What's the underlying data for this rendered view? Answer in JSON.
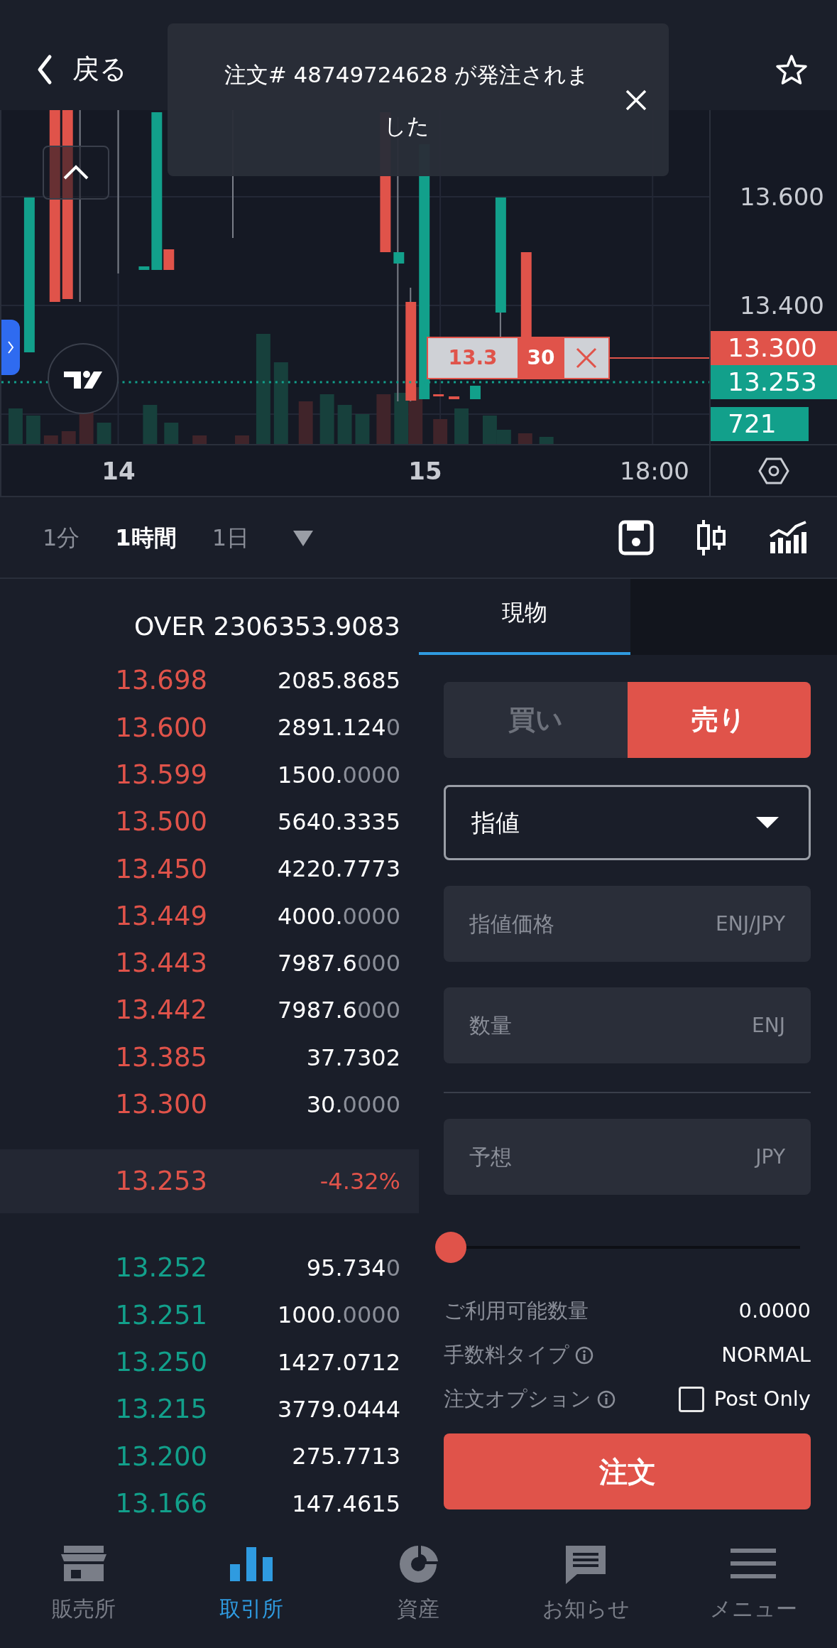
{
  "header": {
    "back_label": "戻る"
  },
  "notification": {
    "message": "注文# 48749724628 が発注されました"
  },
  "chart": {
    "price_ticks": [
      "13.600",
      "13.400"
    ],
    "time_labels": [
      "14",
      "15",
      "18:00"
    ],
    "order_line": {
      "price": "13.3",
      "quantity": "30"
    },
    "price_tags": [
      {
        "kind": "order",
        "text": "13.300"
      },
      {
        "kind": "last",
        "text": "13.253"
      },
      {
        "kind": "volume",
        "text": "721"
      }
    ]
  },
  "intervals": [
    {
      "label": "1分",
      "selected": false
    },
    {
      "label": "1時間",
      "selected": true
    },
    {
      "label": "1日",
      "selected": false
    }
  ],
  "order_book": {
    "header": "OVER 2306353.9083",
    "asks": [
      {
        "price": "13.698",
        "amount": "2085.8685"
      },
      {
        "price": "13.600",
        "amount": "2891.124",
        "amount_dim": "0"
      },
      {
        "price": "13.599",
        "amount": "1500.",
        "amount_dim": "0000"
      },
      {
        "price": "13.500",
        "amount": "5640.3335"
      },
      {
        "price": "13.450",
        "amount": "4220.7773"
      },
      {
        "price": "13.449",
        "amount": "4000.",
        "amount_dim": "0000"
      },
      {
        "price": "13.443",
        "amount": "7987.6",
        "amount_dim": "000"
      },
      {
        "price": "13.442",
        "amount": "7987.6",
        "amount_dim": "000"
      },
      {
        "price": "13.385",
        "amount": "37.7302"
      },
      {
        "price": "13.300",
        "amount": "30.",
        "amount_dim": "0000"
      }
    ],
    "last_price": "13.253",
    "change": "-4.32%",
    "bids": [
      {
        "price": "13.252",
        "amount": "95.734",
        "amount_dim": "0"
      },
      {
        "price": "13.251",
        "amount": "1000.",
        "amount_dim": "0000"
      },
      {
        "price": "13.250",
        "amount": "1427.0712"
      },
      {
        "price": "13.215",
        "amount": "3779.0444"
      },
      {
        "price": "13.200",
        "amount": "275.7713"
      },
      {
        "price": "13.166",
        "amount": "147.4615"
      }
    ]
  },
  "order_form": {
    "tabs": [
      {
        "label": "現物",
        "selected": true
      }
    ],
    "sides": [
      {
        "label": "買い",
        "selected": false
      },
      {
        "label": "売り",
        "selected": true
      }
    ],
    "order_type": "指値",
    "fields": [
      {
        "placeholder": "指値価格",
        "unit": "ENJ/JPY"
      },
      {
        "placeholder": "数量",
        "unit": "ENJ"
      },
      {
        "placeholder": "予想",
        "unit": "JPY"
      }
    ],
    "slider": {
      "level": 0
    },
    "info": [
      {
        "kind": "plain",
        "label": "ご利用可能数量",
        "value": "0.0000"
      },
      {
        "kind": "info",
        "label": "手数料タイプ",
        "value": "NORMAL"
      },
      {
        "kind": "checkbox",
        "label": "注文オプション",
        "option": "Post Only",
        "checked": false
      }
    ],
    "submit": "注文"
  },
  "bottom_nav": [
    {
      "label": "販売所",
      "selected": false
    },
    {
      "label": "取引所",
      "selected": true
    },
    {
      "label": "資産",
      "selected": false
    },
    {
      "label": "お知らせ",
      "selected": false
    },
    {
      "label": "メニュー",
      "selected": false
    }
  ]
}
